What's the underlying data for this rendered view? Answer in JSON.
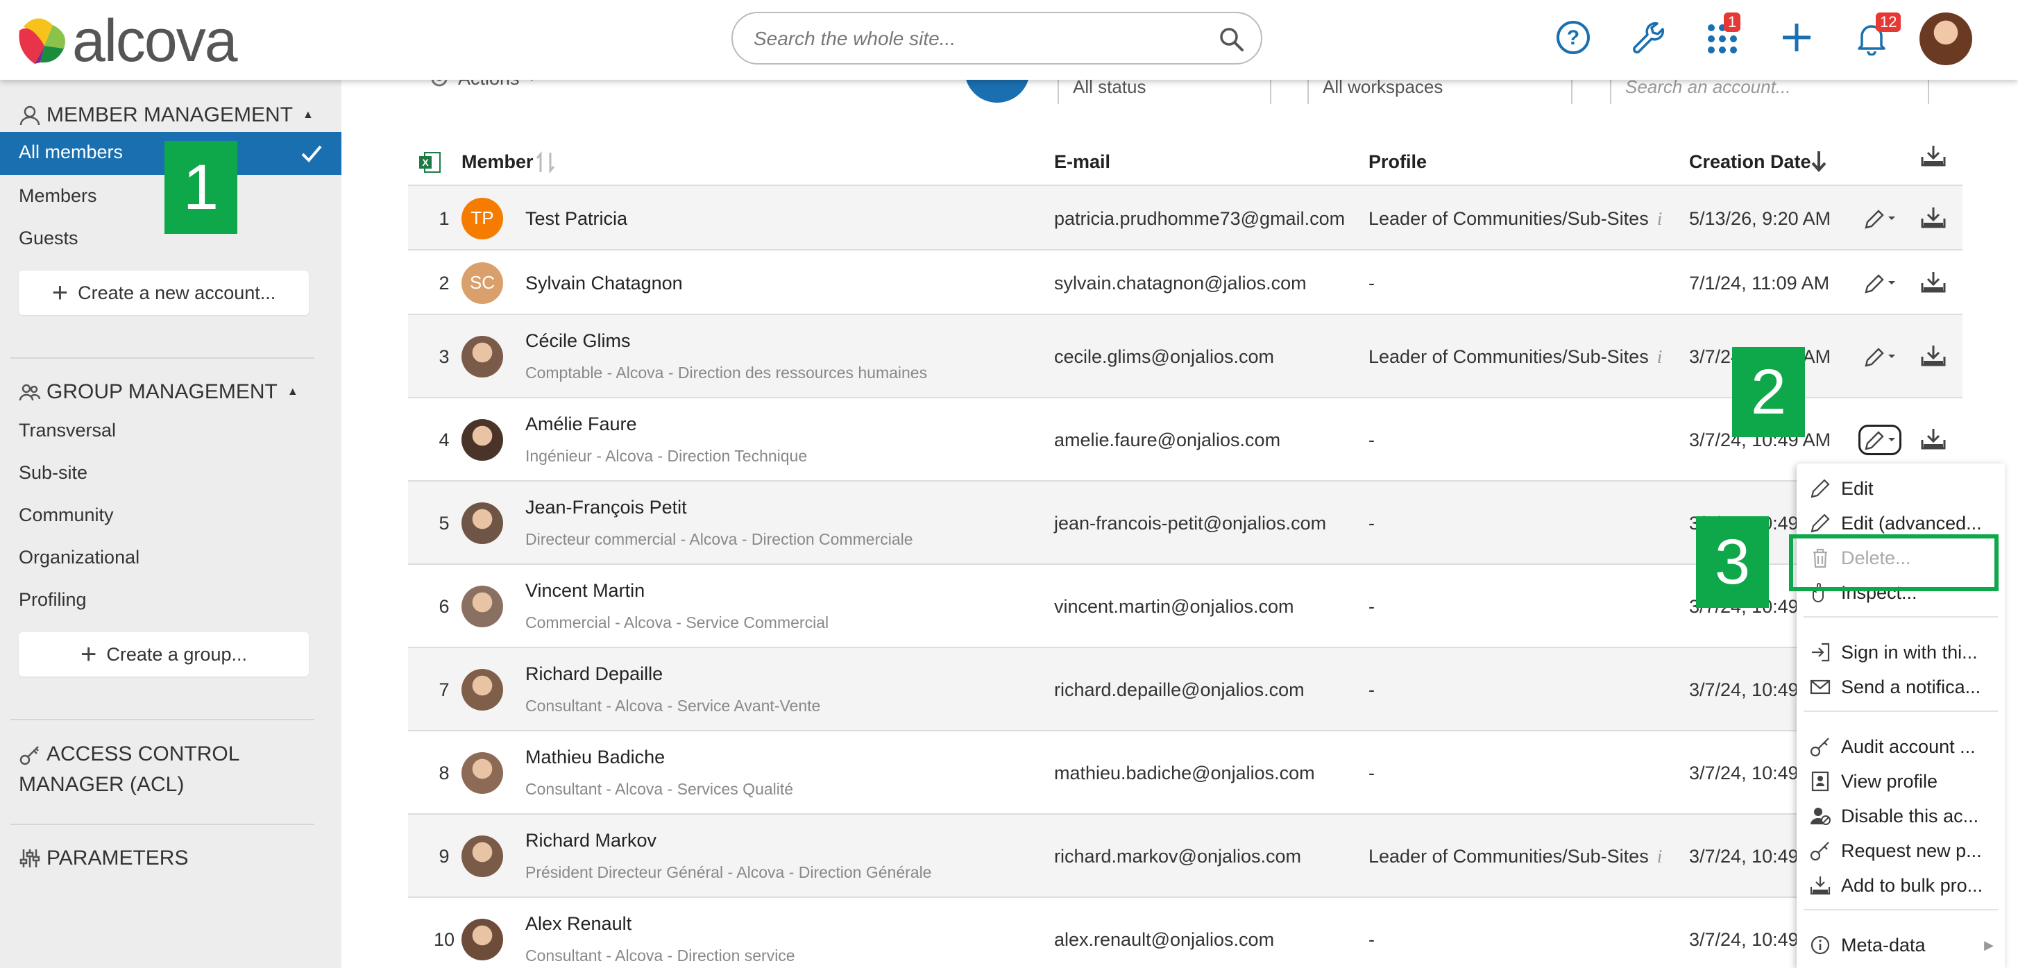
{
  "header": {
    "logo_text": "alcova",
    "search_placeholder": "Search the whole site...",
    "apps_badge": "1",
    "notif_badge": "12"
  },
  "sidebar": {
    "member_mgmt_title": "MEMBER MANAGEMENT",
    "member_items": [
      "All members",
      "Members",
      "Guests"
    ],
    "create_account": "Create a new account...",
    "group_mgmt_title": "GROUP MANAGEMENT",
    "group_items": [
      "Transversal",
      "Sub-site",
      "Community",
      "Organizational",
      "Profiling"
    ],
    "create_group": "Create a group...",
    "acl_title_1": "ACCESS CONTROL",
    "acl_title_2": "MANAGER (ACL)",
    "params_title": "PARAMETERS"
  },
  "filters": {
    "actions": "Actions",
    "status": "All status",
    "workspaces": "All workspaces",
    "account_search": "Search an account..."
  },
  "table": {
    "headers": {
      "member": "Member",
      "email": "E-mail",
      "profile": "Profile",
      "created": "Creation Date"
    },
    "rows": [
      {
        "n": "1",
        "name": "Test Patricia",
        "desc": "",
        "email": "patricia.prudhomme73@gmail.com",
        "profile": "Leader of Communities/Sub-Sites",
        "date": "5/13/26, 9:20 AM",
        "initials": "TP"
      },
      {
        "n": "2",
        "name": "Sylvain Chatagnon",
        "desc": "",
        "email": "sylvain.chatagnon@jalios.com",
        "profile": "-",
        "date": "7/1/24, 11:09 AM",
        "initials": "SC"
      },
      {
        "n": "3",
        "name": "Cécile Glims",
        "desc": "Comptable - Alcova - Direction des ressources humaines",
        "email": "cecile.glims@onjalios.com",
        "profile": "Leader of Communities/Sub-Sites",
        "date": "3/7/24, 10:49 AM"
      },
      {
        "n": "4",
        "name": "Amélie Faure",
        "desc": "Ingénieur - Alcova - Direction Technique",
        "email": "amelie.faure@onjalios.com",
        "profile": "-",
        "date": "3/7/24, 10:49 AM"
      },
      {
        "n": "5",
        "name": "Jean-François Petit",
        "desc": "Directeur commercial - Alcova - Direction Commerciale",
        "email": "jean-francois-petit@onjalios.com",
        "profile": "-",
        "date": "3/7/24, 10:49"
      },
      {
        "n": "6",
        "name": "Vincent Martin",
        "desc": "Commercial - Alcova - Service Commercial",
        "email": "vincent.martin@onjalios.com",
        "profile": "-",
        "date": "3/7/24, 10:49"
      },
      {
        "n": "7",
        "name": "Richard Depaille",
        "desc": "Consultant - Alcova - Service Avant-Vente",
        "email": "richard.depaille@onjalios.com",
        "profile": "-",
        "date": "3/7/24, 10:49"
      },
      {
        "n": "8",
        "name": "Mathieu Badiche",
        "desc": "Consultant - Alcova - Services Qualité",
        "email": "mathieu.badiche@onjalios.com",
        "profile": "-",
        "date": "3/7/24, 10:49"
      },
      {
        "n": "9",
        "name": "Richard Markov",
        "desc": "Président Directeur Général - Alcova - Direction Générale",
        "email": "richard.markov@onjalios.com",
        "profile": "Leader of Communities/Sub-Sites",
        "date": "3/7/24, 10:49"
      },
      {
        "n": "10",
        "name": "Alex Renault",
        "desc": "Consultant - Alcova - Direction service",
        "email": "alex.renault@onjalios.com",
        "profile": "-",
        "date": "3/7/24, 10:49"
      }
    ]
  },
  "menu": {
    "edit": "Edit",
    "edit_adv": "Edit (advanced...",
    "delete": "Delete...",
    "inspect": "Inspect...",
    "sign_in": "Sign in with thi...",
    "send_notif": "Send a notifica...",
    "audit": "Audit account ...",
    "view_profile": "View profile",
    "disable": "Disable this ac...",
    "request_pw": "Request new p...",
    "bulk": "Add to bulk pro...",
    "meta": "Meta-data"
  },
  "annotations": {
    "c1": "1",
    "c2": "2",
    "c3": "3"
  },
  "colors": {
    "accent": "#1a6fb0",
    "annotation": "#0ea84a",
    "badge": "#e53935"
  }
}
